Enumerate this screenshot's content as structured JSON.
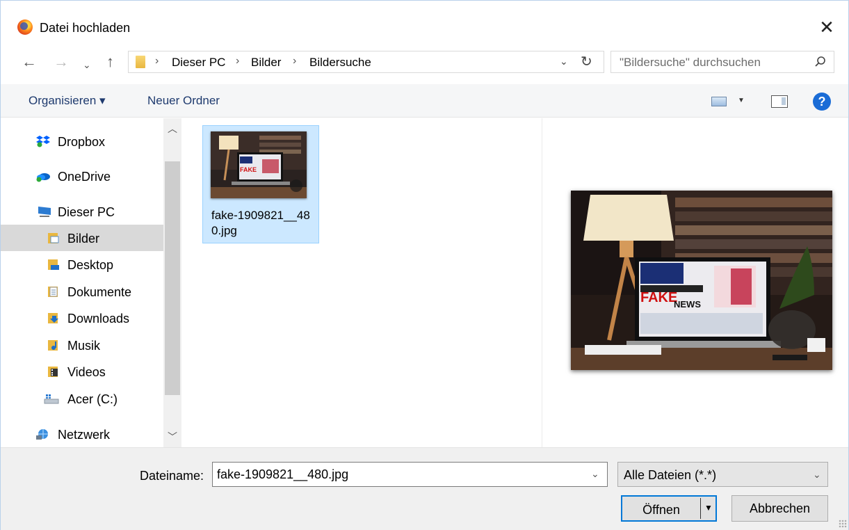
{
  "window": {
    "title": "Datei hochladen",
    "close_symbol": "✕"
  },
  "address_bar": {
    "breadcrumbs": [
      "Dieser PC",
      "Bilder",
      "Bildersuche"
    ],
    "separator": "›"
  },
  "search": {
    "placeholder": "\"Bildersuche\" durchsuchen"
  },
  "toolbar": {
    "organize_label": "Organisieren ▾",
    "new_folder_label": "Neuer Ordner",
    "help_label": "?"
  },
  "sidebar": {
    "items": [
      {
        "label": "Dropbox",
        "icon": "dropbox-icon"
      },
      {
        "label": "OneDrive",
        "icon": "onedrive-icon"
      },
      {
        "label": "Dieser PC",
        "icon": "computer-icon"
      },
      {
        "label": "Bilder",
        "icon": "pictures-folder-icon",
        "selected": true
      },
      {
        "label": "Desktop",
        "icon": "desktop-folder-icon"
      },
      {
        "label": "Dokumente",
        "icon": "documents-folder-icon"
      },
      {
        "label": "Downloads",
        "icon": "downloads-folder-icon"
      },
      {
        "label": "Musik",
        "icon": "music-folder-icon"
      },
      {
        "label": "Videos",
        "icon": "videos-folder-icon"
      },
      {
        "label": "Acer (C:)",
        "icon": "drive-icon"
      },
      {
        "label": "Netzwerk",
        "icon": "network-icon"
      }
    ]
  },
  "files": [
    {
      "name": "fake-1909821__480.jpg",
      "selected": true
    }
  ],
  "preview": {
    "screen_text": "FAKE NEWS"
  },
  "footer": {
    "filename_label": "Dateiname:",
    "filename_value": "fake-1909821__480.jpg",
    "filetype_value": "Alle Dateien (*.*)",
    "open_label": "Öffnen",
    "cancel_label": "Abbrechen"
  },
  "colors": {
    "accent": "#0078d7",
    "selection": "#cce8ff",
    "link_text": "#1e3a6e"
  }
}
